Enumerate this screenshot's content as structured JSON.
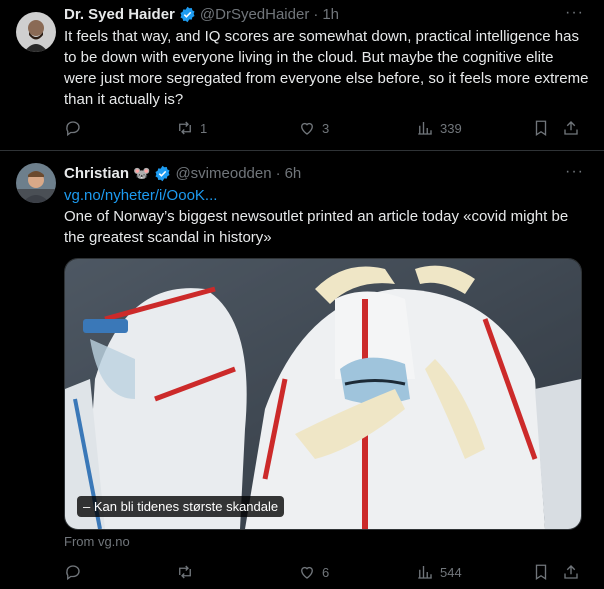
{
  "tweets": [
    {
      "author_name": "Dr. Syed Haider",
      "handle": "@DrSyedHaider",
      "time": "1h",
      "more": "···",
      "text": "It feels that way, and IQ scores are somewhat down, practical intelligence has to be down with everyone living in the cloud. But maybe the cognitive elite were just more segregated from everyone else before, so it feels more extreme than it actually is?",
      "replies": "",
      "retweets": "1",
      "likes": "3",
      "views": "339"
    },
    {
      "author_name": "Christian",
      "author_emoji": "🐭",
      "handle": "@svimeodden",
      "time": "6h",
      "more": "···",
      "link": "vg.no/nyheter/i/OooK...",
      "text": "One of Norway’s biggest newsoutlet printed an article today «covid might be the greatest scandal in history»",
      "media_caption": "– Kan bli tidenes største skandale",
      "from_label": "From vg.no",
      "replies": "",
      "retweets": "",
      "likes": "6",
      "views": "544"
    }
  ],
  "colors": {
    "accent": "#1d9bf0",
    "muted": "#71767b",
    "text": "#e7e9ea",
    "background": "#000000",
    "divider": "#2f3336"
  },
  "icons": [
    "reply-icon",
    "retweet-icon",
    "like-icon",
    "views-icon",
    "bookmark-icon",
    "share-icon",
    "verified-icon",
    "more-icon"
  ]
}
